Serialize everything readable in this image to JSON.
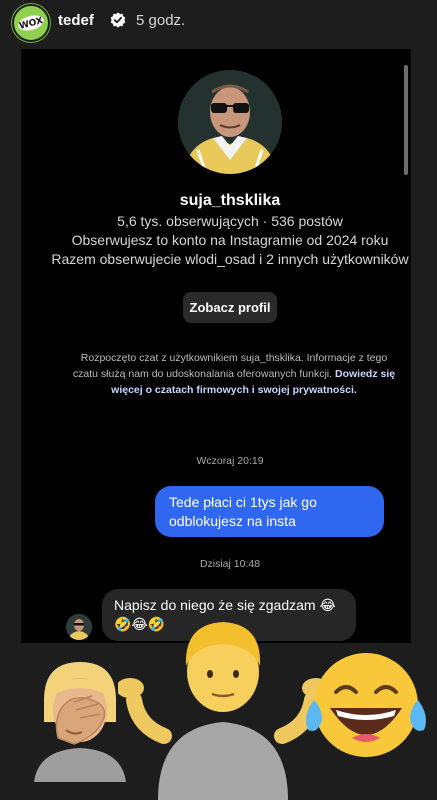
{
  "story": {
    "username": "tedef",
    "time": "5 godz.",
    "avatar_icon": "wox-logo-icon",
    "avatar_logo_text": "WOX"
  },
  "profile": {
    "username": "suja_thsklika",
    "stats": "5,6 tys. obserwujących · 536 postów",
    "follow_since": "Obserwujesz to konto na Instagramie od 2024 roku",
    "mutual": "Razem obserwujecie wlodi_osad i 2 innych użytkowników",
    "view_button": "Zobacz profil"
  },
  "info": {
    "text": "Rozpoczęto czat z użytkownikiem suja_thsklika. Informacje z tego czatu służą nam do udoskonalania oferowanych funkcji.",
    "link": "Dowiedz się więcej o czatach firmowych i swojej prywatności."
  },
  "messages": [
    {
      "timestamp": "Wczoraj 20:19",
      "direction": "sent",
      "text": "Tede płaci ci 1tys jak go odblokujesz na insta"
    },
    {
      "timestamp": "Dzisiaj 10:48",
      "direction": "received",
      "text": "Napisz do niego że się  zgadzam 😂🤣😂🤣"
    }
  ],
  "stickers": [
    "facepalm-emoji",
    "shrug-emoji",
    "laughing-tears-emoji"
  ],
  "colors": {
    "background": "#1d1d1d",
    "chat_background": "#000000",
    "sent_bubble": "#2f67f0",
    "received_bubble": "#262626",
    "avatar_green": "#8fd14f",
    "link": "#c8d6ff"
  }
}
